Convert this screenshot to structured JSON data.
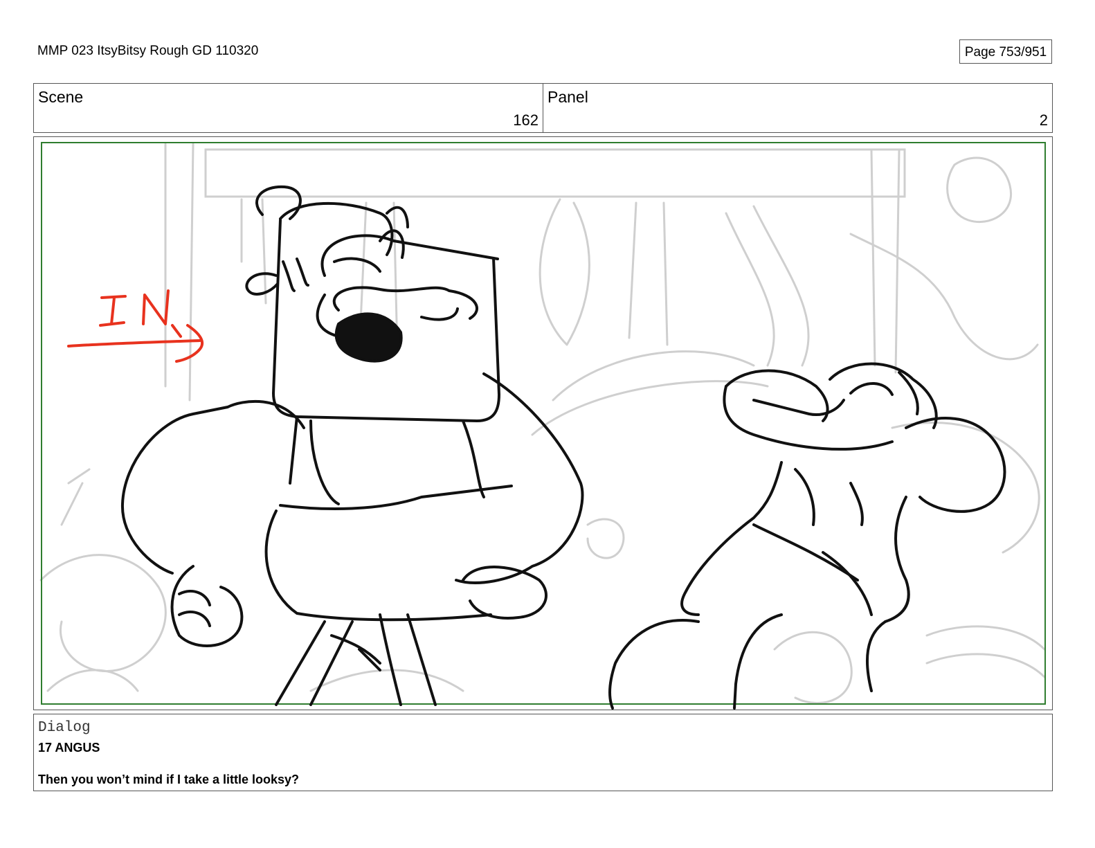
{
  "document": {
    "title": "MMP 023 ItsyBitsy Rough GD 110320",
    "page": "Page 753/951"
  },
  "header": {
    "scene_label": "Scene",
    "scene_value": "162",
    "panel_label": "Panel",
    "panel_value": "2"
  },
  "panel": {
    "annotation": "IN",
    "annotation_color": "#e8321e",
    "safe_frame_color": "#2f7d2f",
    "characters": [
      "angus-sketch",
      "creature-sketch"
    ]
  },
  "dialog": {
    "label": "Dialog",
    "speaker": "17 ANGUS",
    "line": "Then you won’t mind if I take a little looksy?"
  }
}
